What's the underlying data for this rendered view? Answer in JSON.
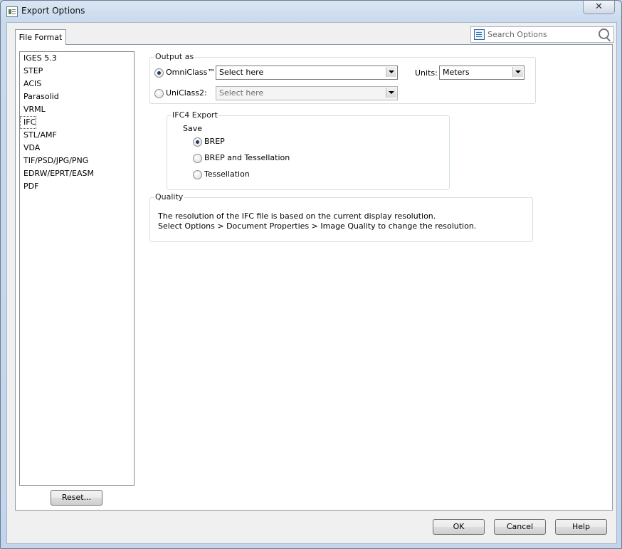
{
  "window": {
    "title": "Export Options",
    "close_label": "✕"
  },
  "tab": {
    "label": "File Format"
  },
  "search": {
    "placeholder": "Search Options"
  },
  "formats": [
    "IGES 5.3",
    "STEP",
    "ACIS",
    "Parasolid",
    "VRML",
    "IFC",
    "STL/AMF",
    "VDA",
    "TIF/PSD/JPG/PNG",
    "EDRW/EPRT/EASM",
    "PDF"
  ],
  "selected_format": "IFC",
  "reset_label": "Reset...",
  "output_as": {
    "legend": "Output as",
    "omniclass_label": "OmniClass™:",
    "omniclass_value": "Select here",
    "uniclass_label": "UniClass2:",
    "uniclass_value": "Select here",
    "units_label": "Units:",
    "units_value": "Meters",
    "selected": "OmniClass™"
  },
  "ifc4": {
    "legend": "IFC4 Export",
    "save_label": "Save",
    "options": [
      "BREP",
      "BREP and Tessellation",
      "Tessellation"
    ],
    "selected": "BREP"
  },
  "quality": {
    "legend": "Quality",
    "line1": "The resolution of the IFC file is based on the current display resolution.",
    "line2": "Select Options > Document Properties > Image Quality to change the resolution."
  },
  "buttons": {
    "ok": "OK",
    "cancel": "Cancel",
    "help": "Help"
  },
  "icons": {
    "app": "export-options-icon",
    "search_list": "options-list-icon",
    "magnifier": "search-icon"
  }
}
